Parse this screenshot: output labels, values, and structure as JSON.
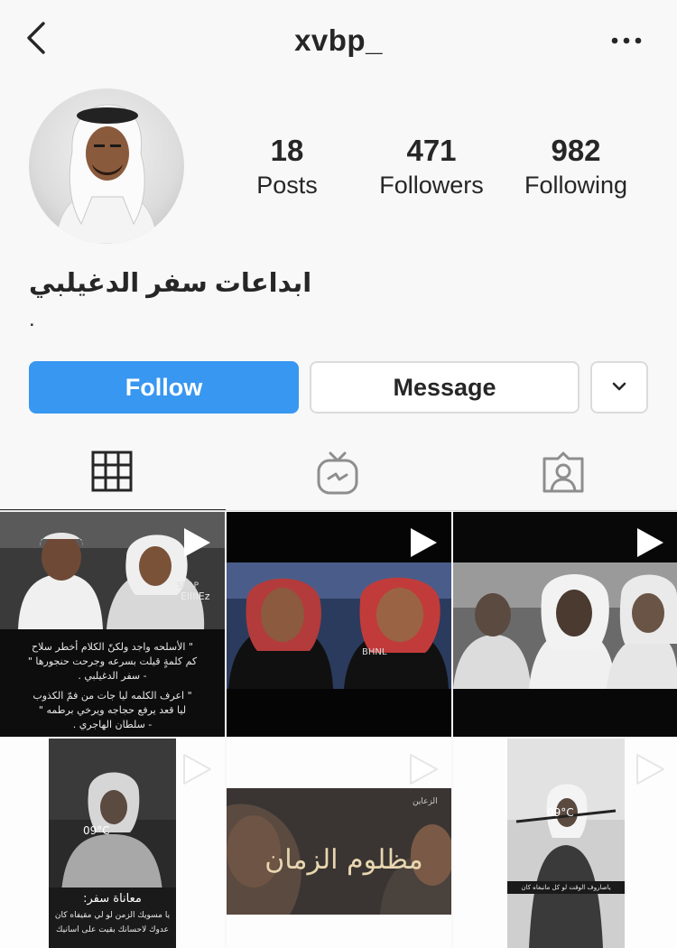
{
  "header": {
    "username": "xvbp_",
    "back_icon": "chevron-left-icon",
    "more_icon": "more-horizontal-icon"
  },
  "profile": {
    "avatar": "profile-photo",
    "stats": [
      {
        "value": "18",
        "label": "Posts"
      },
      {
        "value": "471",
        "label": "Followers"
      },
      {
        "value": "982",
        "label": "Following"
      }
    ],
    "name": "ابداعات سفر الدغيلبي",
    "bio": "."
  },
  "actions": {
    "follow_label": "Follow",
    "message_label": "Message",
    "dropdown_icon": "chevron-down-icon",
    "follow_color": "#3897f0"
  },
  "tabs": [
    {
      "name": "grid-icon",
      "active": true
    },
    {
      "name": "igtv-icon",
      "active": false
    },
    {
      "name": "tagged-icon",
      "active": false
    }
  ],
  "posts": {
    "tile1_caption": [
      "\" الأسلحه واجد ولكنّ الكلام أخطر سلاح",
      "كم كلمةٍ قيلت بسرعه وجرحت حنجورها \"",
      "- سفر الدغيلبي .",
      "\" اعرف الكلمه ليا جات من فمّ الكذوب",
      "ليا قعد يرفع حجاجه ويرخي برطمه \"",
      "- سلطان الهاجري ."
    ],
    "tile1_tag": "SNAP",
    "tile1_watermark": "ElIIIEz",
    "tile2_watermark": "BHNL",
    "tile4_temp": "09°C",
    "tile4_caption_title": "معاناة سفر:",
    "tile4_caption": [
      "يا مسويك الزمن لو لي مقيفاه كان",
      "عدوك لاحسانك بقيت على اسانيك"
    ],
    "tile5_title": "مظلوم الزمان",
    "tile5_tag": "الزعاين",
    "tile6_temp": "09°C",
    "tile6_caption": "ياصاروف الوقت لو كل ماتبغاه كان"
  }
}
